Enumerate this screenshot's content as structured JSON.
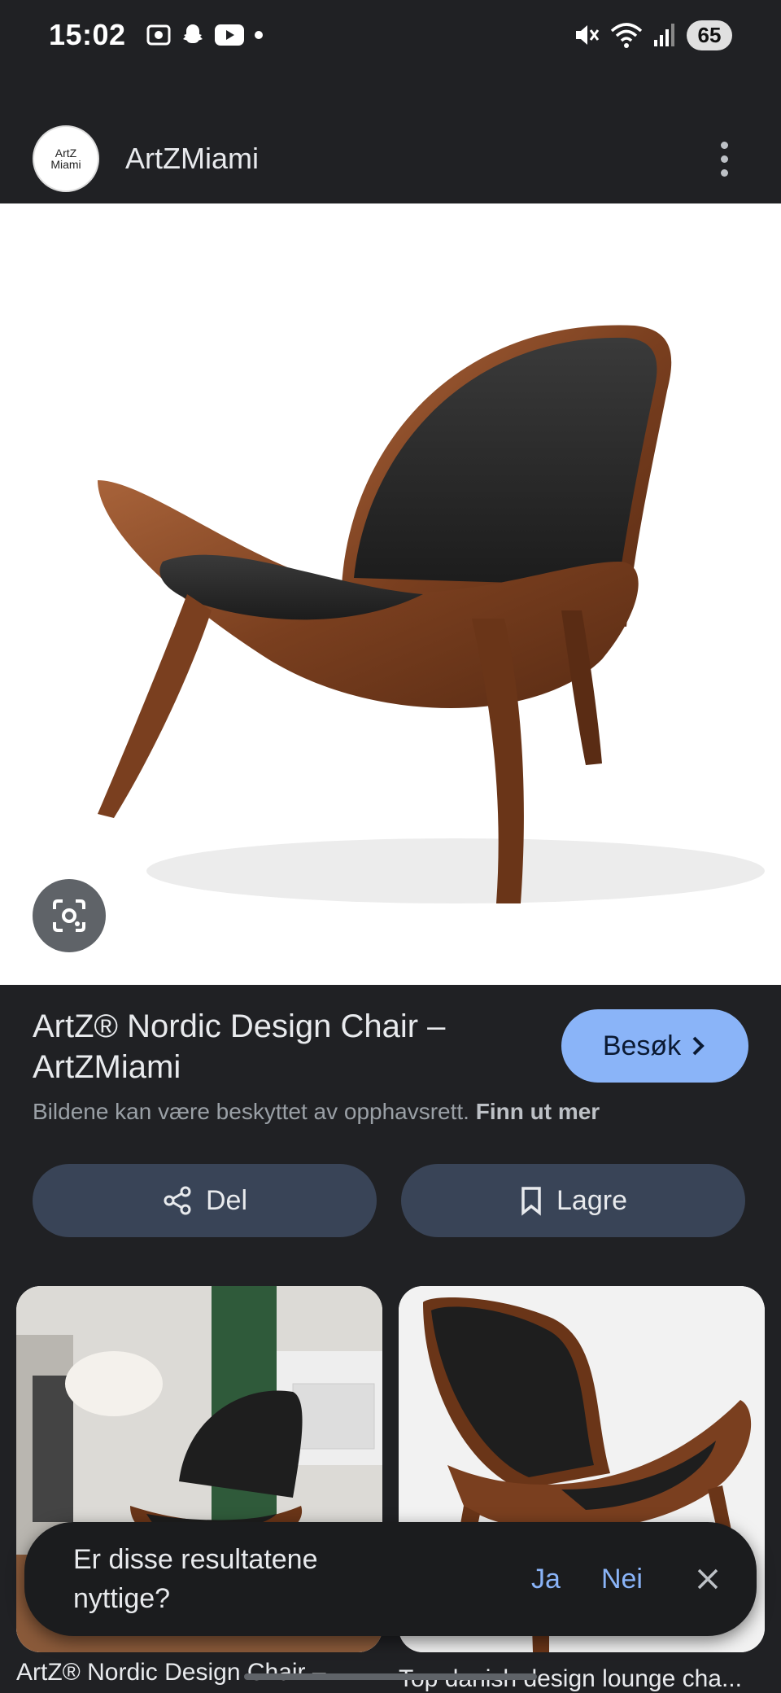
{
  "status_bar": {
    "time": "15:02",
    "battery": "65",
    "icons": [
      "screen-record-icon",
      "snapchat-icon",
      "youtube-icon",
      "dot-icon",
      "mute-icon",
      "wifi-icon",
      "signal-icon"
    ]
  },
  "header": {
    "source_name": "ArtZMiami",
    "avatar_text_a": "ArtZ",
    "avatar_text_b": "Miami"
  },
  "result": {
    "title": "ArtZ® Nordic Design Chair – ArtZMiami",
    "visit_label": "Besøk",
    "copyright_text": "Bildene kan være beskyttet av opphavsrett.",
    "copyright_link": "Finn ut mer"
  },
  "actions": {
    "share_label": "Del",
    "save_label": "Lagre"
  },
  "related": [
    {
      "caption": "ArtZ® Nordic Design Chair –..."
    },
    {
      "caption": "Top danish design lounge cha..."
    }
  ],
  "feedback": {
    "question": "Er disse resultatene nyttige?",
    "yes_label": "Ja",
    "no_label": "Nei"
  },
  "colors": {
    "background": "#202124",
    "accent": "#8ab4f8",
    "button_bg": "#394457"
  }
}
